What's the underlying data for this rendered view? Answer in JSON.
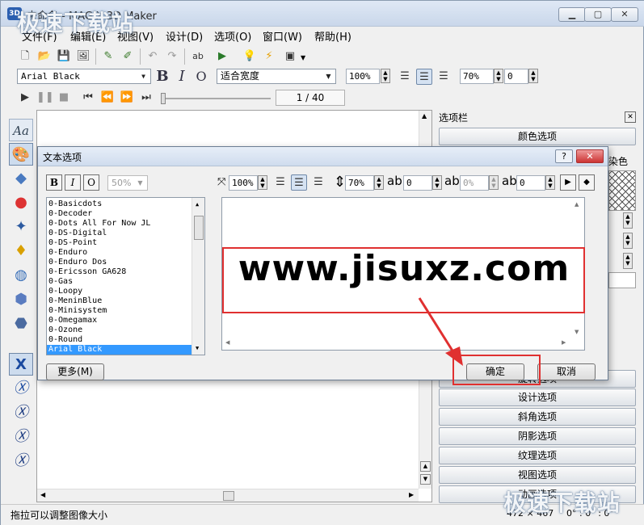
{
  "window": {
    "title": "未命名 - MAGIX 3D Maker",
    "icon_label": "3D"
  },
  "watermark": "极速下载站",
  "menu": [
    "文件(F)",
    "编辑(E)",
    "视图(V)",
    "设计(D)",
    "选项(O)",
    "窗口(W)",
    "帮助(H)"
  ],
  "toolbar2": {
    "font": "Arial Black",
    "bold": "B",
    "italic": "I",
    "outline": "O",
    "fit": "适合宽度",
    "zoom": "100%",
    "opacity": "70%",
    "offset": "0"
  },
  "toolbar3": {
    "frame_counter": "1 / 40"
  },
  "panel": {
    "header": "选项栏",
    "color_button": "颜色选项",
    "partial_label": "染色",
    "buttons": [
      "设计选项",
      "斜角选项",
      "阴影选项",
      "纹理选项",
      "视图选项"
    ],
    "hidden_button_partial": "旋转选项",
    "hidden_bottom_partial": "动画选项"
  },
  "status": {
    "hint": "拖拉可以调整图像大小",
    "size": "472 × 467",
    "angle": "0° : 0° : 0°"
  },
  "dialog": {
    "title": "文本选项",
    "help": "?",
    "close": "✕",
    "bold": "B",
    "italic": "I",
    "outline": "O",
    "size": "50%",
    "scale": "100%",
    "height": "70%",
    "spacing": "0",
    "width_pct": "0%",
    "baseline": "0",
    "fonts": [
      "0-Basicdots",
      "0-Decoder",
      "0-Dots All For Now JL",
      "0-DS-Digital",
      "0-DS-Point",
      "0-Enduro",
      "0-Enduro Dos",
      "0-Ericsson GA628",
      "0-Gas",
      "0-Loopy",
      "0-MeninBlue",
      "0-Minisystem",
      "0-Omegamax",
      "0-Ozone",
      "0-Round",
      "Arial Black"
    ],
    "selected_font": "Arial Black",
    "preview_text": "www.jisuxz.com",
    "more_button": "更多(M)",
    "ok_button": "确定",
    "cancel_button": "取消"
  },
  "colors": {
    "highlight": "#e03030",
    "selection": "#3399ff"
  }
}
